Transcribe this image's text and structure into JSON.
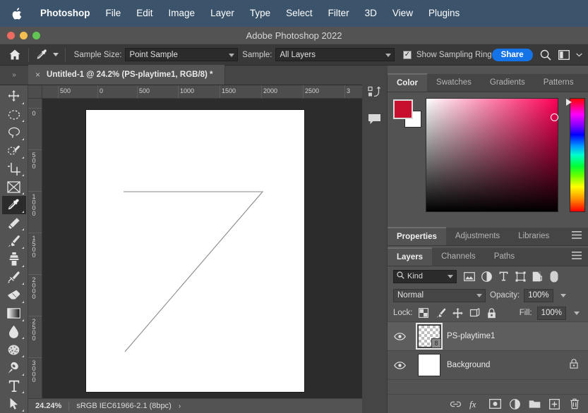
{
  "menubar": {
    "apple_icon": "apple-logo-icon",
    "items": [
      {
        "label": "Photoshop",
        "bold": true
      },
      {
        "label": "File",
        "bold": false
      },
      {
        "label": "Edit",
        "bold": false
      },
      {
        "label": "Image",
        "bold": false
      },
      {
        "label": "Layer",
        "bold": false
      },
      {
        "label": "Type",
        "bold": false
      },
      {
        "label": "Select",
        "bold": false
      },
      {
        "label": "Filter",
        "bold": false
      },
      {
        "label": "3D",
        "bold": false
      },
      {
        "label": "View",
        "bold": false
      },
      {
        "label": "Plugins",
        "bold": false
      }
    ],
    "bg_color": "#3c546b"
  },
  "titlebar": {
    "title": "Adobe Photoshop 2022",
    "close_label": "",
    "minimize_label": "",
    "zoom_label": ""
  },
  "options_bar": {
    "home_icon": "home-icon",
    "tool_icon": "eyedropper-icon",
    "tool_preset_chevron": "chevron-down-icon",
    "sample_size_label": "Sample Size:",
    "sample_size_value": "Point Sample",
    "sample_label": "Sample:",
    "sample_value": "All Layers",
    "show_sampling_ring_label": "Show Sampling Ring",
    "show_sampling_ring_checked": "✓",
    "share_label": "Share",
    "search_icon": "search-icon",
    "workspace_icon": "workspace-icon",
    "workspace_chevron": "chevron-down-icon"
  },
  "tabbar": {
    "collapse_icon": "»",
    "close_icon": "×",
    "document_title": "Untitled-1 @ 24.2% (PS-playtime1, RGB/8) *"
  },
  "toolbox": {
    "tools": [
      {
        "name": "move-tool",
        "active": false
      },
      {
        "name": "rectangular-marquee-tool",
        "active": false
      },
      {
        "name": "lasso-tool",
        "active": false
      },
      {
        "name": "object-selection-tool",
        "active": false
      },
      {
        "name": "crop-tool",
        "active": false
      },
      {
        "name": "frame-tool",
        "active": false
      },
      {
        "name": "eyedropper-tool",
        "active": true
      },
      {
        "name": "spot-healing-brush-tool",
        "active": false
      },
      {
        "name": "brush-tool",
        "active": false
      },
      {
        "name": "clone-stamp-tool",
        "active": false
      },
      {
        "name": "history-brush-tool",
        "active": false
      },
      {
        "name": "eraser-tool",
        "active": false
      },
      {
        "name": "gradient-tool",
        "active": false
      },
      {
        "name": "blur-tool",
        "active": false
      },
      {
        "name": "dodge-tool",
        "active": false
      },
      {
        "name": "pen-tool",
        "active": false
      },
      {
        "name": "type-tool",
        "active": false
      },
      {
        "name": "path-selection-tool",
        "active": false
      }
    ]
  },
  "rulers": {
    "horizontal_ticks": [
      "500",
      "0",
      "500",
      "1000",
      "1500",
      "2000",
      "2500",
      "3"
    ],
    "vertical_ticks": [
      "0",
      "500",
      "1000",
      "1500",
      "2000",
      "2500",
      "3000"
    ]
  },
  "canvas": {
    "artboard_bg": "#ffffff",
    "stroke_color": "#8a8a8a",
    "drawing_description": "seven-shape-path"
  },
  "statusbar": {
    "zoom": "24.24%",
    "color_profile": "sRGB IEC61966-2.1 (8bpc)",
    "expand_icon": "›"
  },
  "minidock": {
    "items": [
      {
        "name": "libraries-icon"
      },
      {
        "name": "comments-icon"
      }
    ]
  },
  "color_panel": {
    "tabs": [
      {
        "label": "Color",
        "active": true
      },
      {
        "label": "Swatches",
        "active": false
      },
      {
        "label": "Gradients",
        "active": false
      },
      {
        "label": "Patterns",
        "active": false
      }
    ],
    "menu_icon": "panel-menu-icon",
    "foreground_color": "#c8102e",
    "background_color": "#ffffff",
    "field_hue": "#ff0055"
  },
  "properties_dock": {
    "tabs": [
      {
        "label": "Properties",
        "active": true
      },
      {
        "label": "Adjustments",
        "active": false
      },
      {
        "label": "Libraries",
        "active": false
      }
    ],
    "menu_icon": "panel-menu-icon"
  },
  "layers_panel": {
    "tabs": [
      {
        "label": "Layers",
        "active": true
      },
      {
        "label": "Channels",
        "active": false
      },
      {
        "label": "Paths",
        "active": false
      }
    ],
    "menu_icon": "panel-menu-icon",
    "filter": {
      "search_icon": "search-icon",
      "kind_label": "Kind",
      "chevron": "chevron-down-icon",
      "icons": [
        {
          "name": "filter-pixel-icon"
        },
        {
          "name": "filter-adjustment-icon"
        },
        {
          "name": "filter-type-icon"
        },
        {
          "name": "filter-shape-icon"
        },
        {
          "name": "filter-smart-object-icon"
        },
        {
          "name": "filter-toggle-icon"
        }
      ]
    },
    "blend_mode": "Normal",
    "opacity_label": "Opacity:",
    "opacity_value": "100%",
    "lock_label": "Lock:",
    "lock_icons": [
      {
        "name": "lock-transparent-pixels-icon"
      },
      {
        "name": "lock-image-pixels-icon"
      },
      {
        "name": "lock-position-icon"
      },
      {
        "name": "lock-artboard-nesting-icon"
      },
      {
        "name": "lock-all-icon"
      }
    ],
    "fill_label": "Fill:",
    "fill_value": "100%",
    "layers": [
      {
        "name": "PS-playtime1",
        "visible": true,
        "selected": true,
        "thumb_type": "transparent",
        "locked": false,
        "badge": "8"
      },
      {
        "name": "Background",
        "visible": true,
        "selected": false,
        "thumb_type": "white",
        "locked": true,
        "badge": ""
      }
    ],
    "footer_icons": [
      {
        "name": "link-layers-icon"
      },
      {
        "name": "layer-styles-fx-icon"
      },
      {
        "name": "add-layer-mask-icon"
      },
      {
        "name": "new-adjustment-layer-icon"
      },
      {
        "name": "new-group-icon"
      },
      {
        "name": "new-layer-icon"
      },
      {
        "name": "delete-layer-icon"
      }
    ]
  }
}
